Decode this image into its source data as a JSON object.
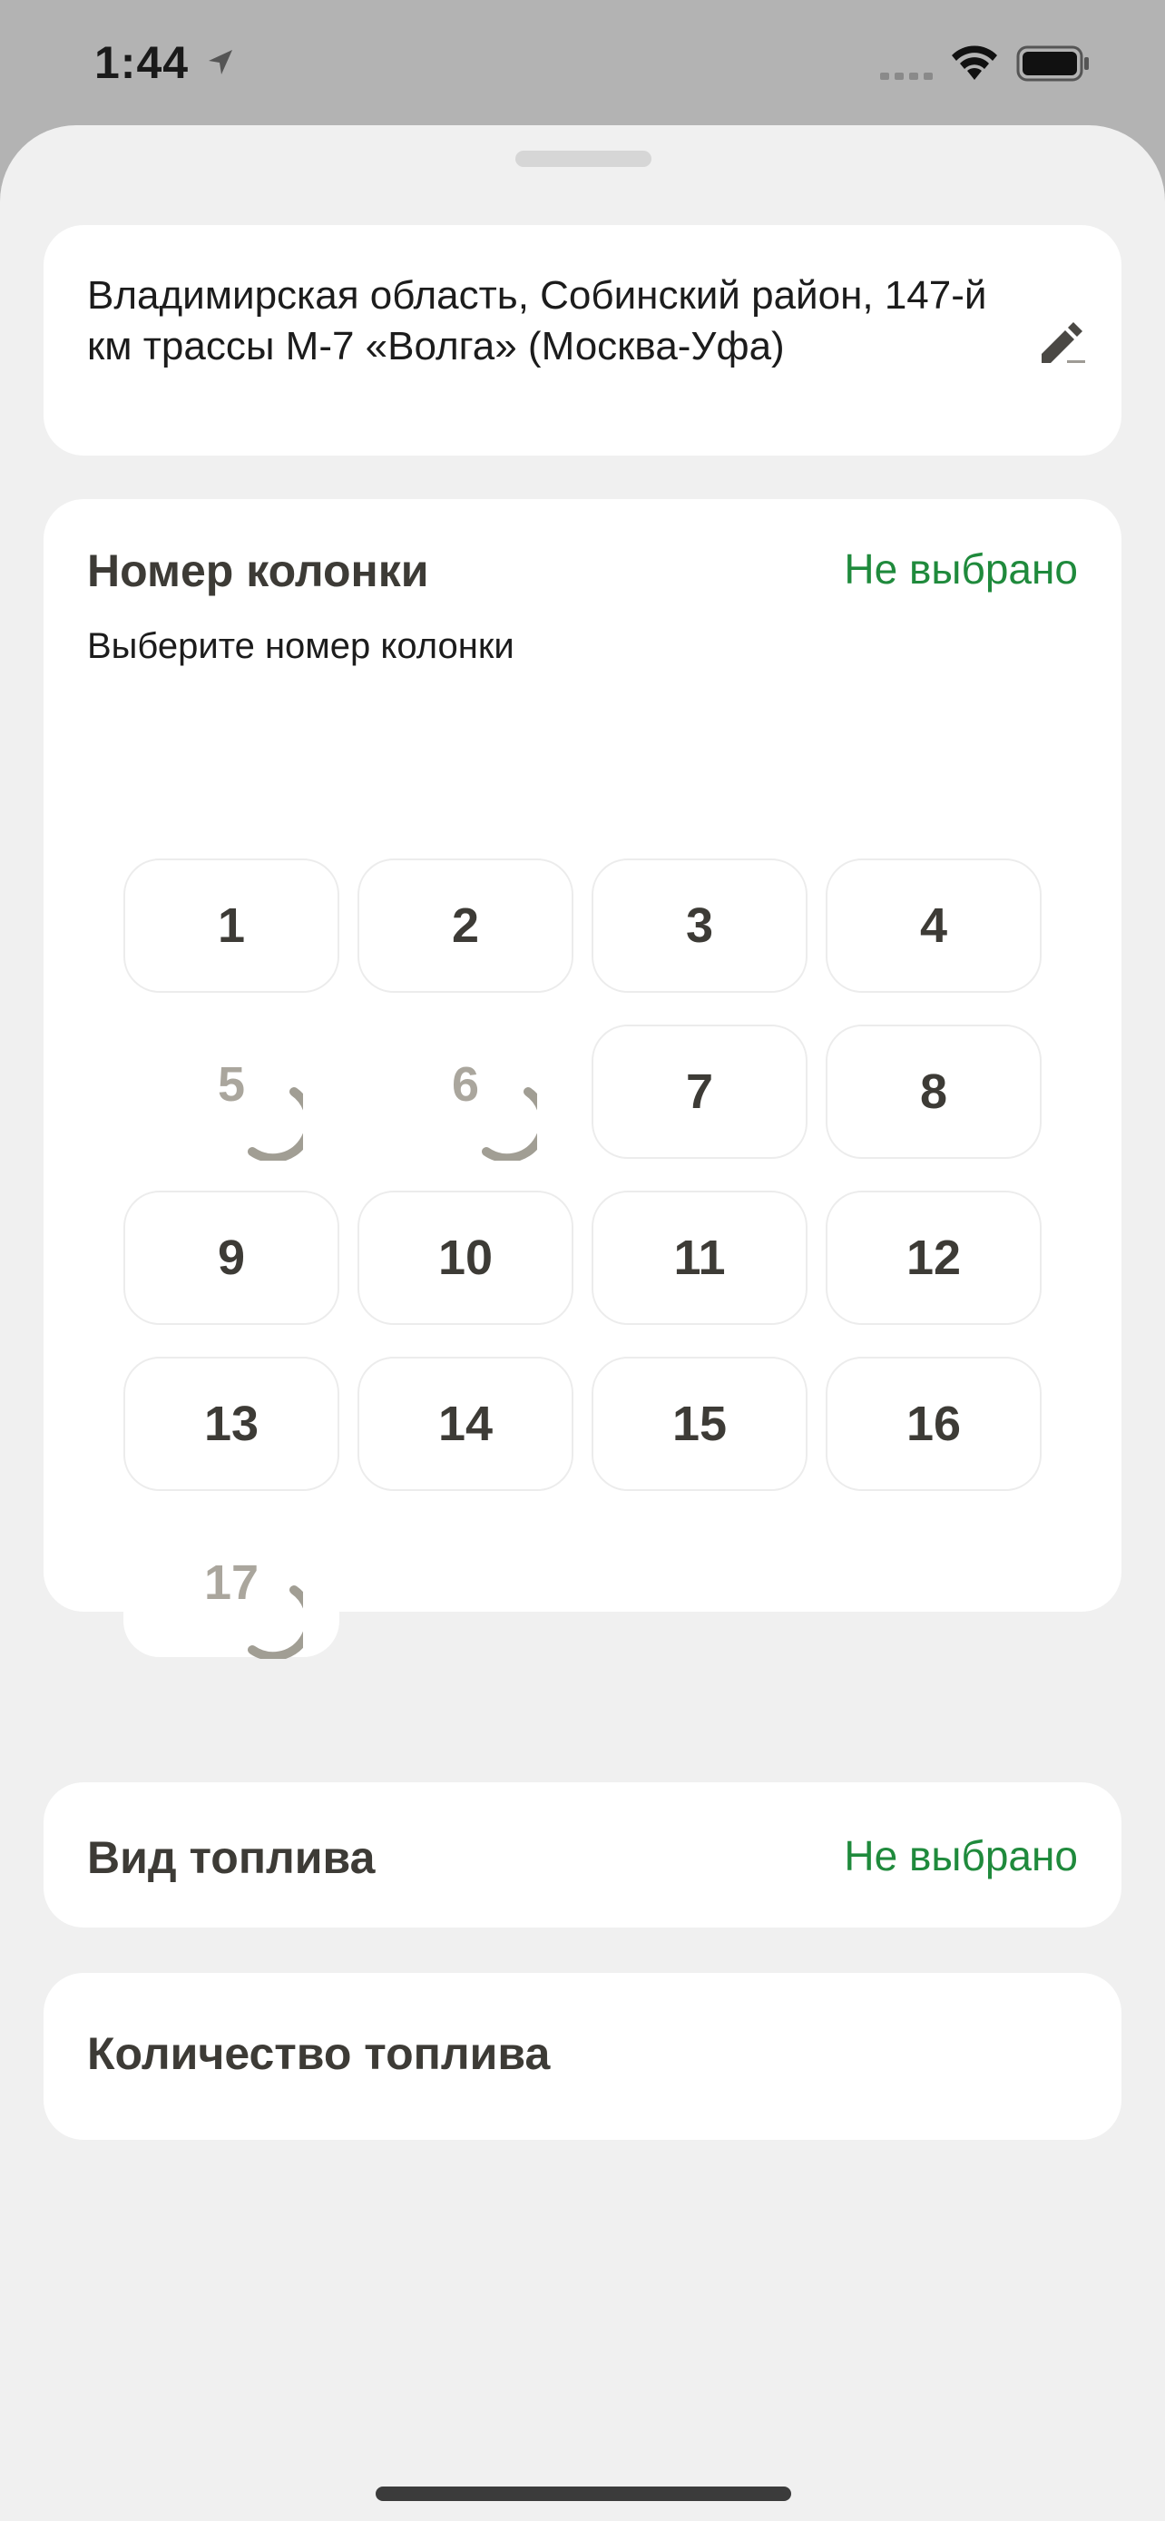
{
  "status_bar": {
    "time": "1:44"
  },
  "address": {
    "text": "Владимирская область, Собинский район, 147-й км трассы М-7 «Волга» (Москва-Уфа)"
  },
  "pump_section": {
    "title": "Номер колонки",
    "status": "Не выбрано",
    "subtitle": "Выберите номер колонки",
    "pumps": [
      {
        "label": "1",
        "loading": false
      },
      {
        "label": "2",
        "loading": false
      },
      {
        "label": "3",
        "loading": false
      },
      {
        "label": "4",
        "loading": false
      },
      {
        "label": "5",
        "loading": true
      },
      {
        "label": "6",
        "loading": true
      },
      {
        "label": "7",
        "loading": false
      },
      {
        "label": "8",
        "loading": false
      },
      {
        "label": "9",
        "loading": false
      },
      {
        "label": "10",
        "loading": false
      },
      {
        "label": "11",
        "loading": false
      },
      {
        "label": "12",
        "loading": false
      },
      {
        "label": "13",
        "loading": false
      },
      {
        "label": "14",
        "loading": false
      },
      {
        "label": "15",
        "loading": false
      },
      {
        "label": "16",
        "loading": false
      },
      {
        "label": "17",
        "loading": true
      }
    ]
  },
  "fuel_type": {
    "title": "Вид топлива",
    "status": "Не выбрано"
  },
  "fuel_quantity": {
    "title": "Количество топлива"
  },
  "colors": {
    "accent_green": "#1f8a3c",
    "text_dark": "#3d3b36",
    "sheet_bg": "#f0f0f0"
  }
}
